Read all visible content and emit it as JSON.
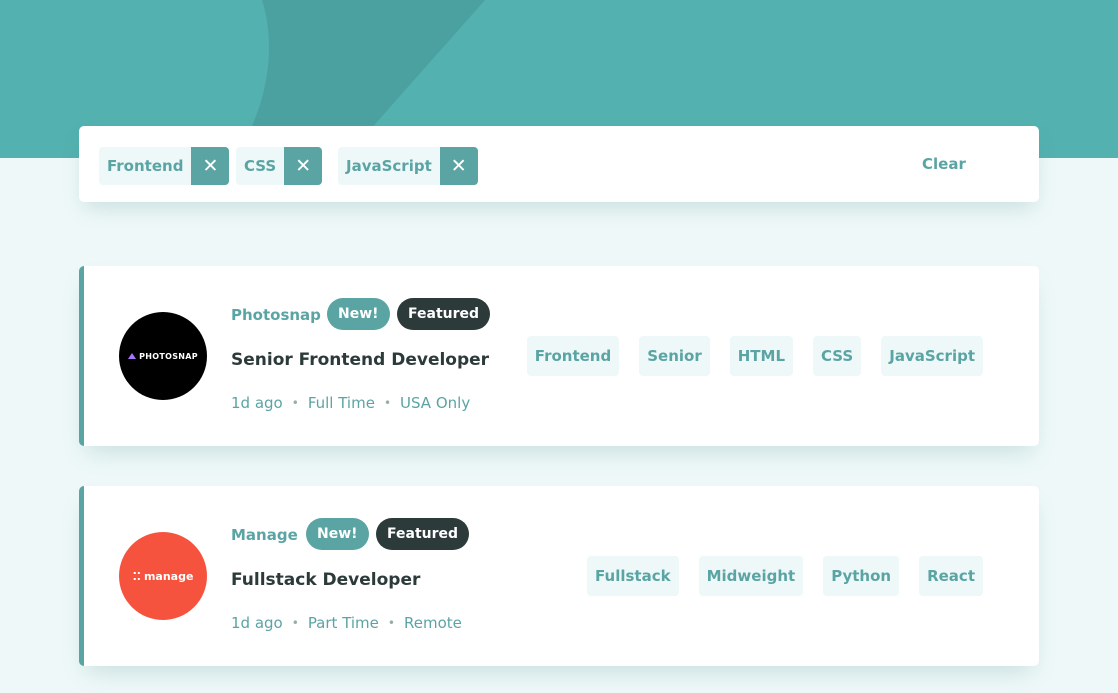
{
  "filters": {
    "active": [
      {
        "label": "Frontend"
      },
      {
        "label": "CSS"
      },
      {
        "label": "JavaScript"
      }
    ],
    "remove_symbol": "✕",
    "clear_label": "Clear"
  },
  "jobs": [
    {
      "company": "Photosnap",
      "logo_text": "PHOTOSNAP",
      "new_label": "New!",
      "featured_label": "Featured",
      "position": "Senior Frontend Developer",
      "posted": "1d ago",
      "contract": "Full Time",
      "location": "USA Only",
      "tags": [
        "Frontend",
        "Senior",
        "HTML",
        "CSS",
        "JavaScript"
      ]
    },
    {
      "company": "Manage",
      "logo_text": "manage",
      "new_label": "New!",
      "featured_label": "Featured",
      "position": "Fullstack Developer",
      "posted": "1d ago",
      "contract": "Part Time",
      "location": "Remote",
      "tags": [
        "Fullstack",
        "Midweight",
        "Python",
        "React"
      ]
    }
  ],
  "meta_separator": "•",
  "colors": {
    "header_bg": "#53b1b0",
    "page_bg": "#eef8f8",
    "primary": "#5ba4a4",
    "dark": "#2c3a3a",
    "manage_logo": "#f5533d"
  }
}
